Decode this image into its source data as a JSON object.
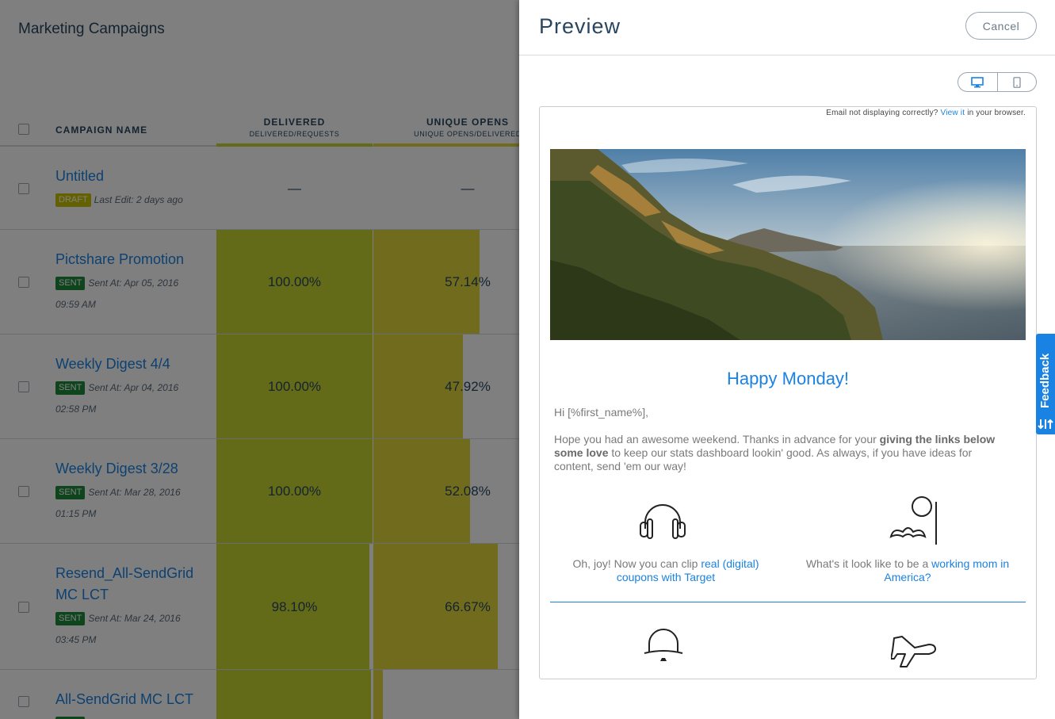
{
  "background": {
    "page_title": "Marketing Campaigns",
    "columns": {
      "campaign_name": "CAMPAIGN NAME",
      "delivered": "DELIVERED",
      "delivered_sub": "DELIVERED/REQUESTS",
      "unique_opens": "UNIQUE OPENS",
      "unique_opens_sub": "UNIQUE OPENS/DELIVERED"
    },
    "rows": [
      {
        "name": "Untitled",
        "status": "DRAFT",
        "meta1": "Last Edit: 2 days ago",
        "meta2": "",
        "delivered": "—",
        "opens": "—",
        "delivered_pct": 0,
        "opens_pct": 0
      },
      {
        "name": "Pictshare Promotion",
        "status": "SENT",
        "meta1": "Sent At: Apr 05, 2016",
        "meta2": "09:59 AM",
        "delivered": "100.00%",
        "opens": "57.14%",
        "delivered_pct": 100,
        "opens_pct": 57.14
      },
      {
        "name": "Weekly Digest 4/4",
        "status": "SENT",
        "meta1": "Sent At: Apr 04, 2016",
        "meta2": "02:58 PM",
        "delivered": "100.00%",
        "opens": "47.92%",
        "delivered_pct": 100,
        "opens_pct": 47.92
      },
      {
        "name": "Weekly Digest 3/28",
        "status": "SENT",
        "meta1": "Sent At: Mar 28, 2016",
        "meta2": "01:15 PM",
        "delivered": "100.00%",
        "opens": "52.08%",
        "delivered_pct": 100,
        "opens_pct": 52.08
      },
      {
        "name": "Resend_All-SendGrid MC LCT",
        "status": "SENT",
        "meta1": "Sent At: Mar 24, 2016",
        "meta2": "03:45 PM",
        "delivered": "98.10%",
        "opens": "66.67%",
        "delivered_pct": 98.1,
        "opens_pct": 66.67
      },
      {
        "name": "All-SendGrid MC LCT",
        "status": "SENT",
        "meta1": "",
        "meta2": "",
        "delivered": "",
        "opens": "",
        "delivered_pct": 99,
        "opens_pct": 5
      }
    ]
  },
  "panel": {
    "title": "Preview",
    "cancel_label": "Cancel",
    "view_toggle": {
      "options": [
        "desktop-icon",
        "mobile-icon"
      ],
      "selected": "desktop-icon"
    },
    "email": {
      "topnote_prefix": "Email not displaying correctly?",
      "topnote_link": "View it",
      "topnote_suffix": "in your browser.",
      "heading": "Happy Monday!",
      "hi": "Hi [%first_name%],",
      "body_1": "Hope you had an awesome weekend. Thanks in advance for your ",
      "body_bold": "giving the links below some love",
      "body_2": " to keep our stats dashboard lookin' good. As always, if you have ideas for content, send 'em our way!",
      "items": [
        {
          "icon": "headphones-icon",
          "text": "Oh, joy! Now you can clip ",
          "link": "real (digital) coupons with Target"
        },
        {
          "icon": "monocle-mustache-icon",
          "text": "What's it look like to be a ",
          "link": "working mom in America?"
        }
      ],
      "lower_icons": [
        "bowler-hat-icon",
        "airplane-icon"
      ]
    }
  },
  "feedback_tab": "Feedback",
  "colors": {
    "brand_blue": "#1a82e2",
    "delivered_bar": "#c9d631",
    "opens_bar": "#e3d93a",
    "sent_badge": "#1f8a3a",
    "draft_badge": "#c8c400"
  }
}
